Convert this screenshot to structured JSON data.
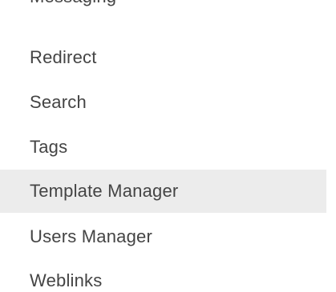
{
  "menu": {
    "partial_item": "Messaging",
    "items": [
      {
        "label": "Redirect"
      },
      {
        "label": "Search"
      },
      {
        "label": "Tags"
      },
      {
        "label": "Template Manager",
        "active": true
      },
      {
        "label": "Users Manager"
      },
      {
        "label": "Weblinks"
      }
    ]
  },
  "colors": {
    "text": "#444444",
    "active_background": "#ececec"
  }
}
